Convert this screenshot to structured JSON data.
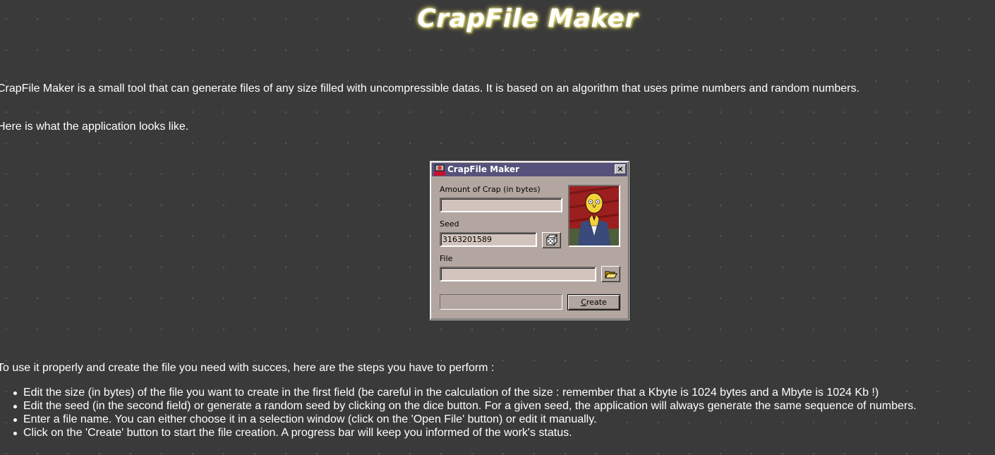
{
  "page": {
    "title": "CrapFile Maker",
    "intro": "CrapFile Maker is a small tool that can generate files of any size filled with uncompressible datas. It is based on an algorithm that uses prime numbers and random numbers.",
    "looks_like": "Here is what the application looks like.",
    "steps_intro": "To use it properly and create the file you need with succes, here are the steps you have to perform :",
    "steps": [
      "Edit the size (in bytes) of the file you want to create in the first field (be careful in the calculation of the size : remember that a Kbyte is 1024 bytes and a Mbyte is 1024 Kb !)",
      "Edit the seed (in the second field) or generate a random seed by clicking on the dice button. For a given seed, the application will always generate the same sequence of numbers.",
      "Enter a file name. You can either choose it in a selection window (click on the 'Open File' button) or edit it manually.",
      "Click on the 'Create' button to start the file creation. A progress bar will keep you informed of the work's status."
    ]
  },
  "dialog": {
    "title": "CrapFile Maker",
    "icon_text": "CRAP",
    "close_label": "×",
    "amount_label": "Amount of Crap (in bytes)",
    "amount_value": "",
    "seed_label": "Seed",
    "seed_value": "3163201589",
    "file_label": "File",
    "file_value": "",
    "create_first": "C",
    "create_rest": "reate",
    "progress": 0
  },
  "icons": {
    "dice": "dice-icon",
    "folder": "open-folder-icon",
    "close": "close-icon"
  },
  "colors": {
    "background": "#000000",
    "dialog_face": "#b3a6a0",
    "titlebar": "#55517a",
    "field": "#d2c4bd"
  }
}
